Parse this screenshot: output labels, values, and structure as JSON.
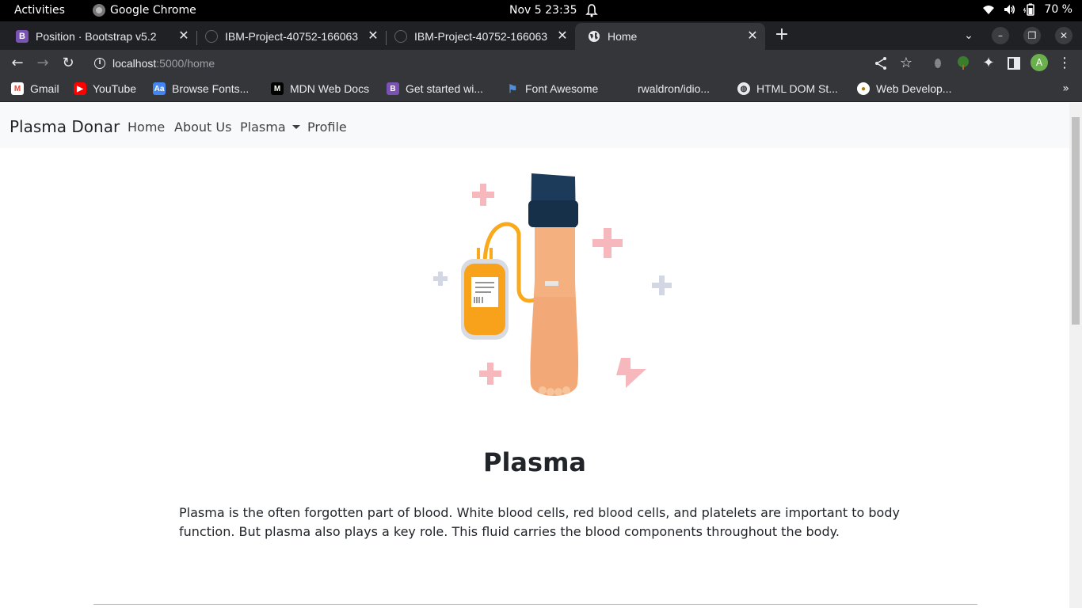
{
  "system": {
    "activities": "Activities",
    "app_name": "Google Chrome",
    "clock": "Nov 5  23:35",
    "battery": "70 %"
  },
  "tabs": [
    {
      "label": "Position · Bootstrap v5.2",
      "favicon": "B",
      "favicon_color": "#7952b3"
    },
    {
      "label": "IBM-Project-40752-166063",
      "favicon": "",
      "favicon_color": "#202124"
    },
    {
      "label": "IBM-Project-40752-166063",
      "favicon": "",
      "favicon_color": "#202124"
    },
    {
      "label": "Home",
      "favicon": "globe-icon",
      "favicon_color": "#e8eaed"
    }
  ],
  "address_bar": {
    "host": "localhost",
    "path": ":5000/home"
  },
  "profile_initial": "A",
  "bookmarks": [
    {
      "label": "Gmail",
      "icon": "gmail-icon",
      "color": "#ea4335"
    },
    {
      "label": "YouTube",
      "icon": "youtube-icon",
      "color": "#ff0000"
    },
    {
      "label": "Browse Fonts...",
      "icon": "google-fonts-icon",
      "color": "#4285f4"
    },
    {
      "label": "MDN Web Docs",
      "icon": "mdn-icon",
      "color": "#000000"
    },
    {
      "label": "Get started wi...",
      "icon": "bootstrap-icon",
      "color": "#7952b3"
    },
    {
      "label": "Font Awesome",
      "icon": "flag-icon",
      "color": "#538dd7"
    },
    {
      "label": "rwaldron/idio...",
      "icon": "github-icon",
      "color": "#35363a"
    },
    {
      "label": "HTML DOM St...",
      "icon": "globe-icon",
      "color": "#e8eaed"
    },
    {
      "label": "Web Develop...",
      "icon": "web-dev-icon",
      "color": "#fbbc04"
    }
  ],
  "navbar": {
    "brand": "Plasma Donar",
    "links": [
      "Home",
      "About Us",
      "Plasma",
      "Profile"
    ]
  },
  "main": {
    "title": "Plasma",
    "paragraph": "Plasma is the often forgotten part of blood. White blood cells, red blood cells, and platelets are important to body function. But plasma also plays a key role. This fluid carries the blood components throughout the body."
  }
}
